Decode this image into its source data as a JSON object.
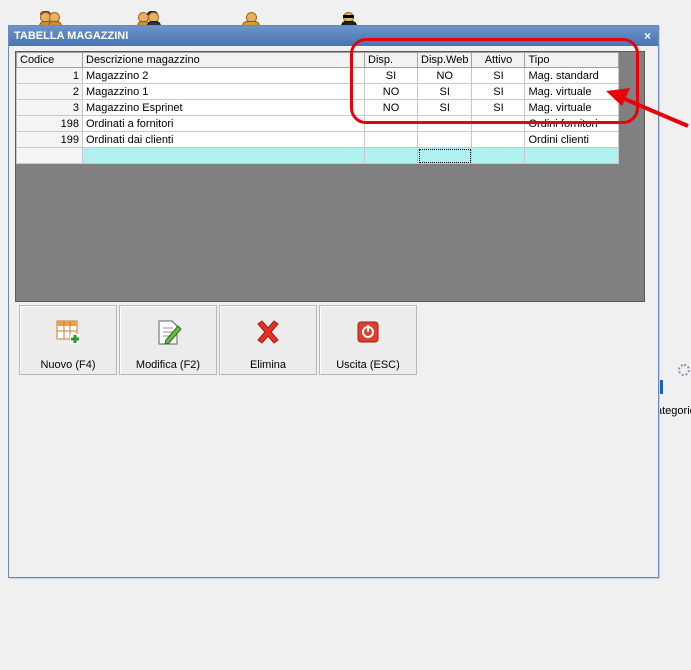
{
  "window": {
    "title": "TABELLA MAGAZZINI"
  },
  "grid": {
    "columns": [
      "Codice",
      "Descrizione magazzino",
      "Disp.",
      "Disp.Web",
      "Attivo",
      "Tipo"
    ],
    "rows": [
      {
        "codice": "1",
        "descrizione": "Magazzino 2",
        "disp": "SI",
        "disp_web": "NO",
        "attivo": "SI",
        "tipo": "Mag. standard"
      },
      {
        "codice": "2",
        "descrizione": "Magazzino 1",
        "disp": "NO",
        "disp_web": "SI",
        "attivo": "SI",
        "tipo": "Mag. virtuale"
      },
      {
        "codice": "3",
        "descrizione": "Magazzino Esprinet",
        "disp": "NO",
        "disp_web": "SI",
        "attivo": "SI",
        "tipo": "Mag. virtuale"
      },
      {
        "codice": "198",
        "descrizione": "Ordinati a fornitori",
        "disp": "",
        "disp_web": "",
        "attivo": "",
        "tipo": "Ordini fornitori"
      },
      {
        "codice": "199",
        "descrizione": "Ordinati dai clienti",
        "disp": "",
        "disp_web": "",
        "attivo": "",
        "tipo": "Ordini clienti"
      }
    ]
  },
  "toolbar": {
    "nuovo": "Nuovo (F4)",
    "modifica": "Modifica (F2)",
    "elimina": "Elimina",
    "uscita": "Uscita (ESC)"
  },
  "desktop": {
    "side_label": "ategorie"
  },
  "colors": {
    "title_bar": "#4a74b0",
    "highlight": "#e8000a",
    "new_row": "#aff0f0",
    "grid_background": "#808080"
  }
}
